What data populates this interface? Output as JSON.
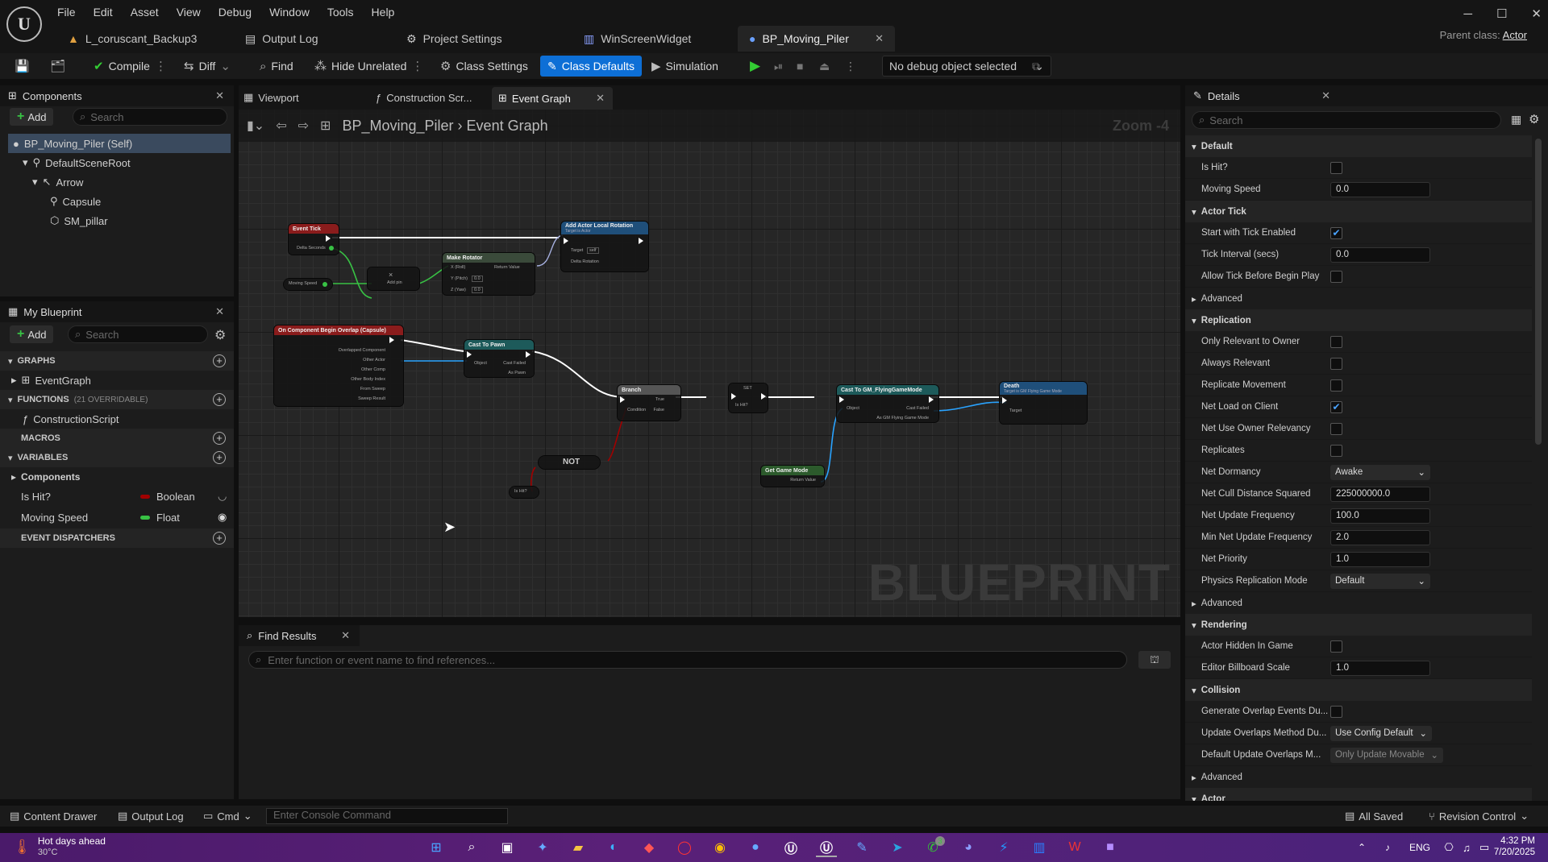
{
  "app": {
    "logo": "U",
    "menu": [
      "File",
      "Edit",
      "Asset",
      "View",
      "Debug",
      "Window",
      "Tools",
      "Help"
    ],
    "tabs": [
      "L_coruscant_Backup3",
      "Output Log",
      "Project Settings",
      "WinScreenWidget",
      "BP_Moving_Piler"
    ],
    "parent_class_label": "Parent class:",
    "parent_class": "Actor",
    "window_icons": [
      "minimize-icon",
      "maximize-icon",
      "close-icon"
    ]
  },
  "toolbar": {
    "compile": "Compile",
    "diff": "Diff",
    "find": "Find",
    "hide_unrelated": "Hide Unrelated",
    "class_settings": "Class Settings",
    "class_defaults": "Class Defaults",
    "simulation": "Simulation",
    "debug_object": "No debug object selected"
  },
  "components": {
    "title": "Components",
    "add": "Add",
    "search_placeholder": "Search",
    "tree": [
      "BP_Moving_Piler (Self)",
      "DefaultSceneRoot",
      "Arrow",
      "Capsule",
      "SM_pillar"
    ]
  },
  "my_blueprint": {
    "title": "My Blueprint",
    "add": "Add",
    "search_placeholder": "Search",
    "sections": {
      "graphs": "GRAPHS",
      "functions": "FUNCTIONS",
      "functions_count": "(21 OVERRIDABLE)",
      "macros": "MACROS",
      "variables": "VARIABLES",
      "dispatchers": "EVENT DISPATCHERS"
    },
    "graphs": [
      "EventGraph"
    ],
    "functions": [
      "ConstructionScript"
    ],
    "var_category": "Components",
    "variables": [
      {
        "name": "Is Hit?",
        "type": "Boolean",
        "color": "#a00000"
      },
      {
        "name": "Moving Speed",
        "type": "Float",
        "color": "#38c144"
      }
    ]
  },
  "graph": {
    "tabs": [
      "Viewport",
      "Construction Scr...",
      "Event Graph"
    ],
    "breadcrumb_bp": "BP_Moving_Piler",
    "breadcrumb_graph": "Event Graph",
    "zoom": "Zoom -4",
    "watermark": "BLUEPRINT",
    "nodes": {
      "event_tick": "Event Tick",
      "delta_seconds": "Delta Seconds",
      "add_rotation": "Add Actor Local Rotation",
      "add_rotation_sub": "Target is Actor",
      "target": "Target",
      "self": "self",
      "delta_rotation": "Delta Rotation",
      "make_rotator": "Make Rotator",
      "x_roll": "X (Roll)",
      "y_pitch": "Y (Pitch)",
      "z_yaw": "Z (Yaw)",
      "zero": "0.0",
      "return_value": "Return Value",
      "moving_speed": "Moving Speed",
      "multiply": "×",
      "add_pin": "Add pin",
      "overlap": "On Component Begin Overlap (Capsule)",
      "overlap_pins": [
        "Overlapped Component",
        "Other Actor",
        "Other Comp",
        "Other Body Index",
        "From Sweep",
        "Sweep Result"
      ],
      "cast_pawn": "Cast To Pawn",
      "object": "Object",
      "cast_failed": "Cast Failed",
      "as_pawn": "As Pawn",
      "branch": "Branch",
      "condition": "Condition",
      "true": "True",
      "false": "False",
      "set": "SET",
      "is_hit": "Is Hit?",
      "not": "NOT",
      "cast_gm": "Cast To GM_FlyingGameMode",
      "as_gm": "As GM Flying Game Mode",
      "get_game_mode": "Get Game Mode",
      "death": "Death",
      "death_sub": "Target is GM Flying Game Mode"
    }
  },
  "find_results": {
    "title": "Find Results",
    "placeholder": "Enter function or event name to find references..."
  },
  "details": {
    "title": "Details",
    "search_placeholder": "Search",
    "default": {
      "label": "Default",
      "is_hit": "Is Hit?",
      "moving_speed": "Moving Speed",
      "moving_speed_val": "0.0"
    },
    "actor_tick": {
      "label": "Actor Tick",
      "start": "Start with Tick Enabled",
      "interval": "Tick Interval (secs)",
      "interval_val": "0.0",
      "allow": "Allow Tick Before Begin Play",
      "advanced": "Advanced"
    },
    "replication": {
      "label": "Replication",
      "only_relevant": "Only Relevant to Owner",
      "always_relevant": "Always Relevant",
      "replicate_movement": "Replicate Movement",
      "net_load": "Net Load on Client",
      "net_use_owner": "Net Use Owner Relevancy",
      "replicates": "Replicates",
      "net_dormancy": "Net Dormancy",
      "net_dormancy_val": "Awake",
      "net_cull": "Net Cull Distance Squared",
      "net_cull_val": "225000000.0",
      "net_update": "Net Update Frequency",
      "net_update_val": "100.0",
      "min_net_update": "Min Net Update Frequency",
      "min_net_update_val": "2.0",
      "net_priority": "Net Priority",
      "net_priority_val": "1.0",
      "physics_mode": "Physics Replication Mode",
      "physics_mode_val": "Default",
      "advanced": "Advanced"
    },
    "rendering": {
      "label": "Rendering",
      "hidden": "Actor Hidden In Game",
      "billboard": "Editor Billboard Scale",
      "billboard_val": "1.0"
    },
    "collision": {
      "label": "Collision",
      "generate": "Generate Overlap Events Du...",
      "update_method": "Update Overlaps Method Du...",
      "update_method_val": "Use Config Default",
      "default_update": "Default Update Overlaps M...",
      "default_update_val": "Only Update Movable",
      "advanced": "Advanced"
    },
    "actor_label": "Actor"
  },
  "statusbar": {
    "content_drawer": "Content Drawer",
    "output_log": "Output Log",
    "cmd": "Cmd",
    "console_placeholder": "Enter Console Command",
    "all_saved": "All Saved",
    "revision": "Revision Control"
  },
  "taskbar": {
    "weather_title": "Hot days ahead",
    "weather_temp": "30°C",
    "lang": "ENG",
    "time": "4:32 PM",
    "date": "7/20/2025",
    "badge": "3"
  }
}
